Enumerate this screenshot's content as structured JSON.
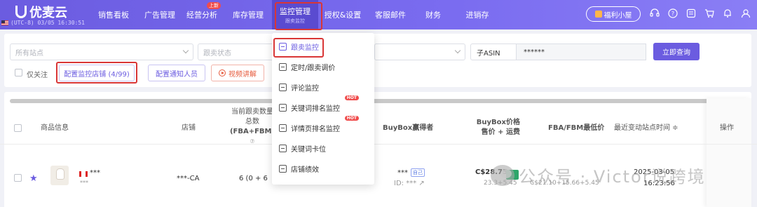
{
  "brand": {
    "name": "优麦云",
    "timezone": "(UTC-8) 03/05 16:30:51"
  },
  "nav": {
    "items": [
      {
        "label": "销售看板",
        "sub": ""
      },
      {
        "label": "广告管理",
        "sub": ""
      },
      {
        "label": "经营分析",
        "sub": ""
      },
      {
        "label": "库存管理",
        "sub": ""
      },
      {
        "label": "监控管理",
        "sub": "跟卖监控"
      },
      {
        "label": "授权&设置",
        "sub": ""
      },
      {
        "label": "客服邮件",
        "sub": ""
      },
      {
        "label": "财务",
        "sub": ""
      },
      {
        "label": "进销存",
        "sub": ""
      }
    ],
    "new_badge": "上新",
    "welfare_label": "福利小屋"
  },
  "filters": {
    "shop_placeholder": "所有站点",
    "status_placeholder": "跟卖状态",
    "asin_type": "子ASIN",
    "asin_value": "******",
    "query_label": "立即查询",
    "only_follow_label": "仅关注",
    "config_shops_label": "配置监控店铺 (4/99)",
    "config_notify_label": "配置通知人员",
    "video_label": "视频讲解"
  },
  "dropdown": {
    "items": [
      {
        "label": "跟卖监控",
        "hot": ""
      },
      {
        "label": "定时/跟卖调价",
        "hot": ""
      },
      {
        "label": "评论监控",
        "hot": ""
      },
      {
        "label": "关键词排名监控",
        "hot": "HOT"
      },
      {
        "label": "详情页排名监控",
        "hot": "HOT"
      },
      {
        "label": "关键词卡位",
        "hot": ""
      },
      {
        "label": "店铺绩效",
        "hot": ""
      }
    ]
  },
  "table": {
    "headers": {
      "product": "商品信息",
      "shop": "店铺",
      "count_l1": "当前跟卖数量",
      "count_l2": "总数",
      "count_l3": "(FBA+FBM)",
      "count_l4": "⑦",
      "buybox_owner": "BuyBox赢得者",
      "buybox_price_l1": "BuyBox价格",
      "buybox_price_l2": "售价 + 运费",
      "min_price": "FBA/FBM最低价",
      "last_change": "最近变动站点时间 ≑",
      "ops": "操作"
    },
    "row": {
      "title": "***",
      "subtitle": "***",
      "shop": "***-CA",
      "count": "6 (0 + 6",
      "owner": "***",
      "owner_tag": "自己",
      "owner_id": "ID: ***",
      "price": "C$28.75",
      "price_breakdown": "23.3+5.45",
      "min_price": "C$21.10+15.66+5.45",
      "date": "2025-03-05",
      "time": "16:23:56"
    }
  },
  "watermark": {
    "text": "公众号 · Victor说跨境"
  },
  "colors": {
    "primary": "#6b5ce0",
    "highlight": "#d93636",
    "hot": "#f04c4c"
  }
}
